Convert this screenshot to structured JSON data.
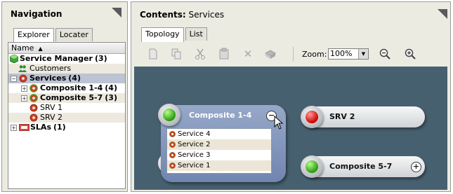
{
  "navigation": {
    "title": "Navigation",
    "tabs": [
      {
        "label": "Explorer",
        "active": true
      },
      {
        "label": "Locater",
        "active": false
      }
    ],
    "column_header": "Name",
    "tree": [
      {
        "label": "Service Manager",
        "count": "(3)",
        "bold": true,
        "indent": 0,
        "icon": "service-manager-icon",
        "expander": "none"
      },
      {
        "label": "Customers",
        "count": "",
        "bold": false,
        "indent": 1,
        "icon": "customers-icon",
        "expander": "none"
      },
      {
        "label": "Services",
        "count": "(4)",
        "bold": true,
        "indent": 0,
        "icon": "services-icon",
        "expander": "minus",
        "selected": true
      },
      {
        "label": "Composite 1-4",
        "count": "(4)",
        "bold": true,
        "indent": 1,
        "icon": "composite-icon",
        "expander": "plus"
      },
      {
        "label": "Composite 5-7",
        "count": "(3)",
        "bold": true,
        "indent": 1,
        "icon": "composite-icon",
        "expander": "plus"
      },
      {
        "label": "SRV 1",
        "count": "",
        "bold": false,
        "indent": 1,
        "icon": "service-icon",
        "expander": "none"
      },
      {
        "label": "SRV 2",
        "count": "",
        "bold": false,
        "indent": 1,
        "icon": "service-icon",
        "expander": "none"
      },
      {
        "label": "SLAs",
        "count": "(1)",
        "bold": true,
        "indent": 0,
        "icon": "slas-icon",
        "expander": "plus"
      }
    ]
  },
  "contents": {
    "title_prefix": "Contents:",
    "title_value": "Services",
    "tabs": [
      {
        "label": "Topology",
        "active": true
      },
      {
        "label": "List",
        "active": false
      }
    ],
    "toolbar": {
      "zoom_label": "Zoom:",
      "zoom_value": "100%"
    },
    "topology": {
      "group": {
        "label": "Composite 1-4",
        "status": "green",
        "control": "−",
        "children": [
          "Service 4",
          "Service 2",
          "Service 3",
          "Service 1"
        ]
      },
      "nodes": [
        {
          "label": "SRV 2",
          "status": "red",
          "control": ""
        },
        {
          "label": "Composite 5-7",
          "status": "green",
          "control": "+"
        }
      ]
    }
  },
  "colors": {
    "canvas": "#476070",
    "panel": "#ecebe2",
    "selection": "#bcc3d2",
    "group": "#7f93bd"
  }
}
